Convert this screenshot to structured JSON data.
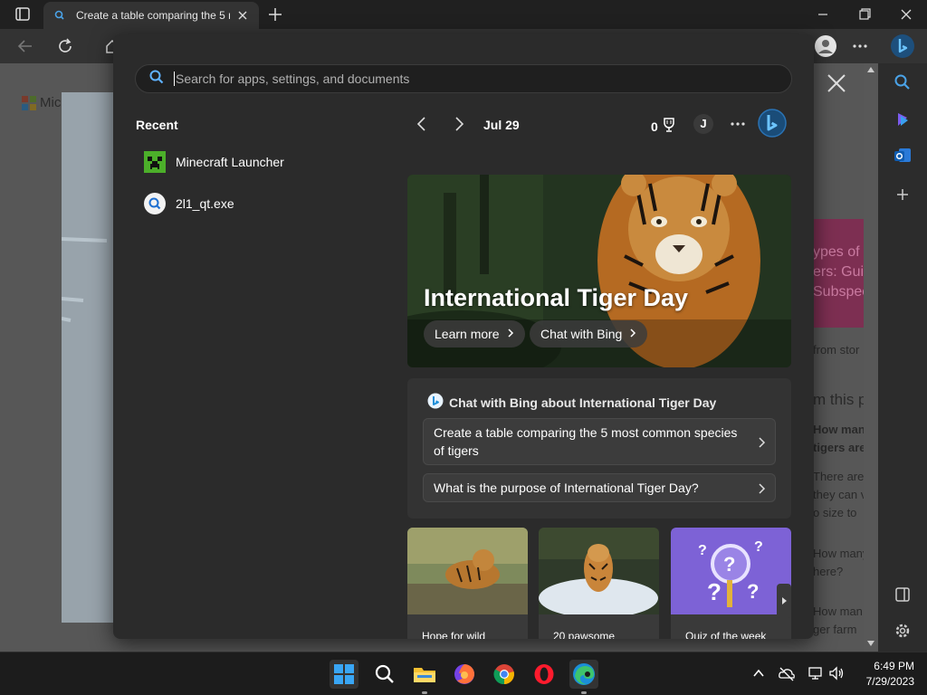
{
  "browser": {
    "tab_title": "Create a table comparing the 5 m",
    "page_partial": {
      "ms_word": "Mic",
      "card_text": [
        "ypes of",
        "ers: Gui",
        "Subspec"
      ],
      "side_lines": [
        {
          "text": "from stor",
          "bold": false
        },
        {
          "text": "m this p",
          "bold": false
        },
        {
          "text": "How many",
          "bold": true
        },
        {
          "text": "tigers are",
          "bold": true
        },
        {
          "text": "There are",
          "bold": false
        },
        {
          "text": "they can v",
          "bold": false
        },
        {
          "text": "o size to",
          "bold": false
        },
        {
          "text": "How many",
          "bold": false
        },
        {
          "text": "here?",
          "bold": false
        },
        {
          "text": "How man",
          "bold": false
        },
        {
          "text": "ger farm",
          "bold": false
        }
      ]
    }
  },
  "search": {
    "placeholder": "Search for apps, settings, and documents",
    "recent_heading": "Recent",
    "recent_items": [
      {
        "label": "Minecraft Launcher",
        "icon": "minecraft-icon"
      },
      {
        "label": "2l1_qt.exe",
        "icon": "search-icon"
      }
    ],
    "date": "Jul 29",
    "points": "0",
    "avatar_initial": "J",
    "hero": {
      "title": "International Tiger Day",
      "learn_more": "Learn more",
      "chat_with_bing": "Chat with Bing"
    },
    "chat": {
      "heading": "Chat with Bing about International Tiger Day",
      "prompts": [
        "Create a table comparing the 5 most common species of tigers",
        "What is the purpose of International Tiger Day?"
      ]
    },
    "thumbs": [
      {
        "label": "Hope for wild"
      },
      {
        "label": "20 pawsome"
      },
      {
        "label": "Quiz of the week"
      }
    ]
  },
  "taskbar": {
    "time": "6:49 PM",
    "date": "7/29/2023"
  },
  "colors": {
    "accent_bing": "#1e8fd8",
    "flyout_bg": "#2b2b2b",
    "taskbar_bg": "#1c1c1c"
  }
}
